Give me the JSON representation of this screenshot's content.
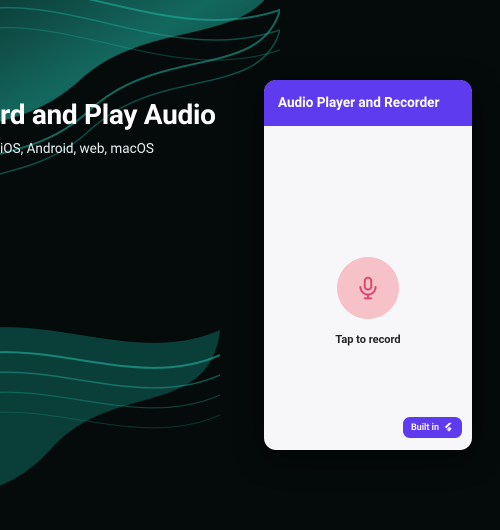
{
  "promo": {
    "title": "rd and Play Audio",
    "subtitle": "iOS, Android, web, macOS"
  },
  "phone": {
    "appbar_title": "Audio Player and Recorder",
    "record_label": "Tap to record",
    "badge_label": "Built in"
  },
  "colors": {
    "accent": "#5e3bee",
    "record_bg": "#f6c1c7",
    "wave": "#1fb5a3"
  }
}
